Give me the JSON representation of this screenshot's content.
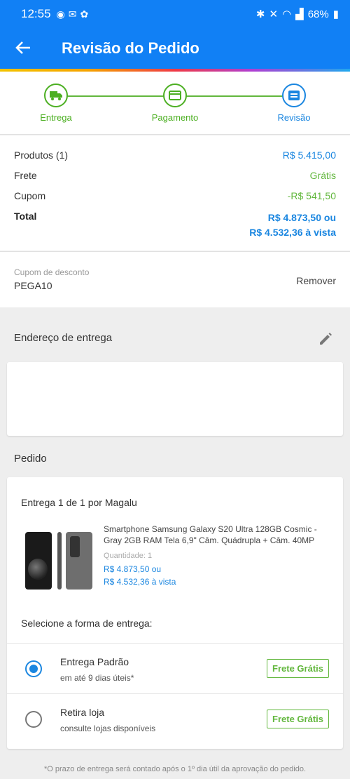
{
  "status_bar": {
    "time": "12:55",
    "battery": "68%"
  },
  "header": {
    "title": "Revisão do Pedido",
    "back_icon": "arrow-left-icon"
  },
  "colors": {
    "primary": "#1180f5",
    "green": "#62b73d",
    "link_blue": "#1a86e0"
  },
  "stepper": {
    "steps": [
      {
        "label": "Entrega",
        "icon": "truck-icon",
        "state": "done"
      },
      {
        "label": "Pagamento",
        "icon": "card-icon",
        "state": "done"
      },
      {
        "label": "Revisão",
        "icon": "review-icon",
        "state": "current"
      }
    ]
  },
  "summary": {
    "products_label": "Produtos (1)",
    "products_value": "R$ 5.415,00",
    "shipping_label": "Frete",
    "shipping_value": "Grátis",
    "coupon_label": "Cupom",
    "coupon_value": "-R$ 541,50",
    "total_label": "Total",
    "total_value_1": "R$ 4.873,50 ou",
    "total_value_2": "R$ 4.532,36 à vista"
  },
  "coupon": {
    "label": "Cupom de desconto",
    "code": "PEGA10",
    "remove": "Remover"
  },
  "address": {
    "title": "Endereço de entrega"
  },
  "order": {
    "title": "Pedido",
    "shipper": "Entrega 1 de 1 por Magalu",
    "product_name": "Smartphone Samsung Galaxy S20 Ultra 128GB Cosmic - Gray 2GB RAM Tela 6,9\" Câm. Quádrupla + Câm. 40MP",
    "quantity": "Quantidade: 1",
    "price_1": "R$ 4.873,50 ou",
    "price_2": "R$ 4.532,36 à vista",
    "select_title": "Selecione a forma de entrega:",
    "options": [
      {
        "name": "Entrega Padrão",
        "desc": "em até 9 dias úteis*",
        "badge": "Frete Grátis",
        "selected": true
      },
      {
        "name": "Retira loja",
        "desc": "consulte lojas disponíveis",
        "badge": "Frete Grátis",
        "selected": false
      }
    ]
  },
  "footnote": "*O prazo de entrega será contado após o 1º dia útil da aprovação do pedido."
}
